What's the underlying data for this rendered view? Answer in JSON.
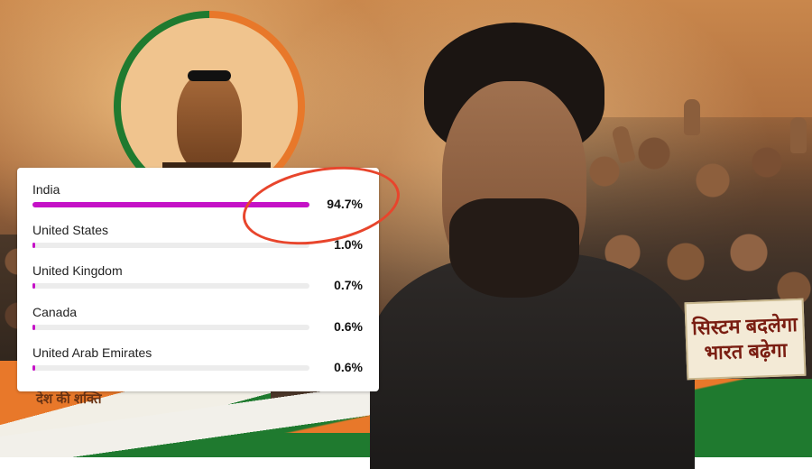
{
  "audience_card": {
    "countries": [
      {
        "name": "India",
        "percent_label": "94.7%",
        "share": 0.947
      },
      {
        "name": "United States",
        "percent_label": "1.0%",
        "share": 0.01
      },
      {
        "name": "United Kingdom",
        "percent_label": "0.7%",
        "share": 0.007
      },
      {
        "name": "Canada",
        "percent_label": "0.6%",
        "share": 0.006
      },
      {
        "name": "United Arab Emirates",
        "percent_label": "0.6%",
        "share": 0.006
      }
    ],
    "bar_color": "#c511c7",
    "highlight_circle_color": "#e8452c"
  },
  "background": {
    "sign_line_1": "सिस्टम बदलेगा",
    "sign_line_2": "भारत बढ़ेगा",
    "caption_fragment": "देश की शक्ति",
    "logo_icon": "cockroach-with-sunglasses-icon",
    "flag_colors": {
      "saffron": "#e8782a",
      "white": "#f2f0ea",
      "green": "#1f7a2f"
    }
  }
}
